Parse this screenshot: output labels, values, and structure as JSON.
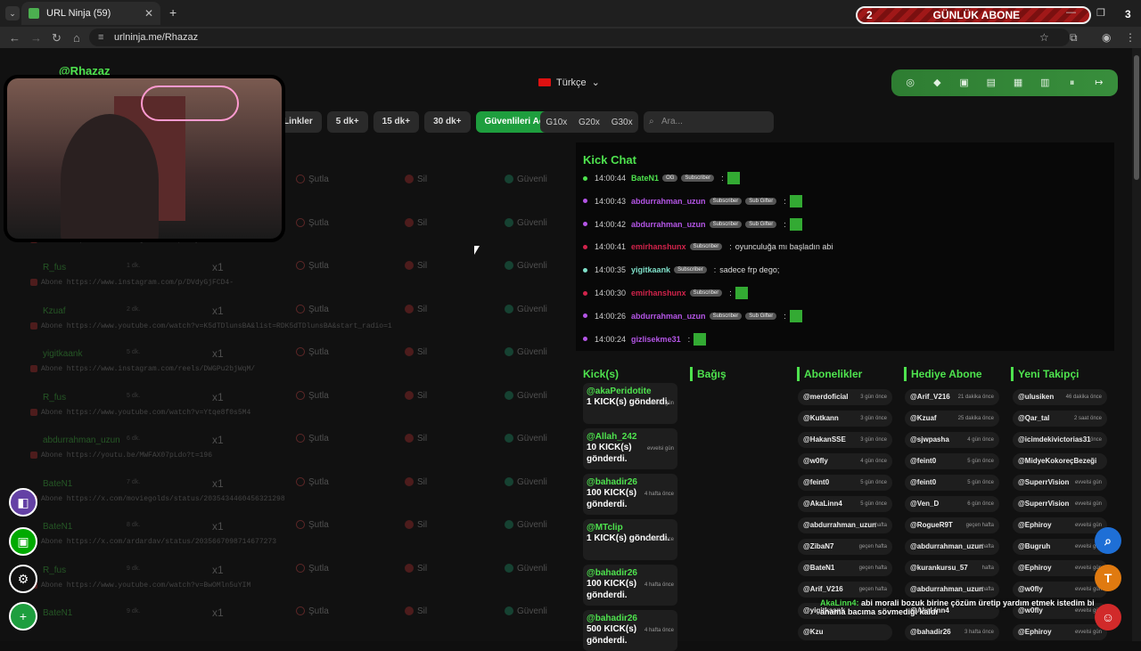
{
  "browser": {
    "tab_title": "URL Ninja (59)",
    "tab_close": "✕",
    "new_tab": "+",
    "url": "urlninja.me/Rhazaz",
    "sub_left": "2",
    "sub_label": "GÜNLÜK ABONE",
    "sub_right": "3"
  },
  "header": {
    "username": "@Rhazaz",
    "language": "Türkçe"
  },
  "filters": {
    "links": "Linkler",
    "b5": "5 dk+",
    "b15": "15 dk+",
    "b30": "30 dk+",
    "safe": "Güvenlileri Aç",
    "g10": "G10x",
    "g20": "G20x",
    "g30": "G30x",
    "search_placeholder": "Ara..."
  },
  "link_actions": {
    "kick": "Şutla",
    "delete": "Sil",
    "safe": "Güvenli"
  },
  "links": [
    {
      "user": "",
      "time": "",
      "count": "",
      "url": ""
    },
    {
      "user": "",
      "time": "",
      "count": "",
      "url": "Abone https://www.instagram.com/p/DVybGmG0lxa"
    },
    {
      "user": "R_fus",
      "time": "1 dk.",
      "count": "x1",
      "url": "Abone https://www.instagram.com/p/DVdyGjFCD4-"
    },
    {
      "user": "Kzuaf",
      "time": "2 dk.",
      "count": "x1",
      "url": "Abone https://www.youtube.com/watch?v=K5dTDlunsBA&list=RDK5dTDlunsBA&start_radio=1"
    },
    {
      "user": "yigitkaank",
      "time": "5 dk.",
      "count": "x1",
      "url": "Abone https://www.instagram.com/reels/DWGPu2bjWqM/"
    },
    {
      "user": "R_fus",
      "time": "5 dk.",
      "count": "x1",
      "url": "Abone https://www.youtube.com/watch?v=Ytqe8f0s5M4"
    },
    {
      "user": "abdurrahman_uzun",
      "time": "6 dk.",
      "count": "x1",
      "url": "Abone https://youtu.be/MWFAX07pLdo?t=196"
    },
    {
      "user": "BateN1",
      "time": "7 dk.",
      "count": "x1",
      "url": "Abone https://x.com/moviegolds/status/2035434460456321298"
    },
    {
      "user": "BateN1",
      "time": "8 dk.",
      "count": "x1",
      "url": "Abone https://x.com/ardardav/status/2035667098714677273"
    },
    {
      "user": "R_fus",
      "time": "9 dk.",
      "count": "x1",
      "url": "Abone https://www.youtube.com/watch?v=BwOMln5uYIM"
    },
    {
      "user": "BateN1",
      "time": "9 dk.",
      "count": "x1",
      "url": ""
    }
  ],
  "chat": {
    "title": "Kick Chat",
    "messages": [
      {
        "time": "14:00:44",
        "name": "BateN1",
        "color": "#4ee34e",
        "dot": "#4ee34e",
        "badges": [
          "OG",
          "Subscriber"
        ],
        "emote": true,
        "text": ""
      },
      {
        "time": "14:00:43",
        "name": "abdurrahman_uzun",
        "color": "#b455e6",
        "dot": "#b455e6",
        "badges": [
          "Subscriber",
          "Sub Gifter"
        ],
        "emote": true,
        "text": ""
      },
      {
        "time": "14:00:42",
        "name": "abdurrahman_uzun",
        "color": "#b455e6",
        "dot": "#b455e6",
        "badges": [
          "Subscriber",
          "Sub Gifter"
        ],
        "emote": true,
        "text": ""
      },
      {
        "time": "14:00:41",
        "name": "emirhanshunx",
        "color": "#d1234b",
        "dot": "#d1234b",
        "badges": [
          "Subscriber"
        ],
        "emote": false,
        "text": "oyunculuğa mı başladın abi"
      },
      {
        "time": "14:00:35",
        "name": "yigitkaank",
        "color": "#7fe0c9",
        "dot": "#7fe0c9",
        "badges": [
          "Subscriber"
        ],
        "emote": false,
        "text": "sadece frp dego;"
      },
      {
        "time": "14:00:30",
        "name": "emirhanshunx",
        "color": "#d1234b",
        "dot": "#d1234b",
        "badges": [
          "Subscriber"
        ],
        "emote": true,
        "text": ""
      },
      {
        "time": "14:00:26",
        "name": "abdurrahman_uzun",
        "color": "#b455e6",
        "dot": "#b455e6",
        "badges": [
          "Subscriber",
          "Sub Gifter"
        ],
        "emote": true,
        "text": ""
      },
      {
        "time": "14:00:24",
        "name": "gizlisekme31",
        "color": "#b455e6",
        "dot": "#b455e6",
        "badges": [],
        "emote": true,
        "text": ""
      }
    ]
  },
  "columns": {
    "kicks": "Kick(s)",
    "donations": "Bağış",
    "subs": "Abonelikler",
    "gift_subs": "Hediye Abone",
    "followers": "Yeni Takipçi"
  },
  "kicks": [
    {
      "name": "@akaPeridotite",
      "text": "1 KICK(s) gönderdi.",
      "time": "evvelsi gün"
    },
    {
      "name": "@Allah_242",
      "text": "10 KICK(s) gönderdi.",
      "time": "evvelsi gün"
    },
    {
      "name": "@bahadir26",
      "text": "100 KICK(s) gönderdi.",
      "time": "4 hafta önce"
    },
    {
      "name": "@MTclip",
      "text": "1 KICK(s) gönderdi.",
      "time": "4 hafta önce"
    },
    {
      "name": "@bahadir26",
      "text": "100 KICK(s) gönderdi.",
      "time": "4 hafta önce"
    },
    {
      "name": "@bahadir26",
      "text": "500 KICK(s) gönderdi.",
      "time": "4 hafta önce"
    }
  ],
  "subs": [
    {
      "n": "@merdoficial",
      "t": "3 gün önce"
    },
    {
      "n": "@Kutkann",
      "t": "3 gün önce"
    },
    {
      "n": "@HakanSSE",
      "t": "3 gün önce"
    },
    {
      "n": "@w0fly",
      "t": "4 gün önce"
    },
    {
      "n": "@feint0",
      "t": "5 gün önce"
    },
    {
      "n": "@AkaLinn4",
      "t": "5 gün önce"
    },
    {
      "n": "@abdurrahman_uzun",
      "t": "hafta"
    },
    {
      "n": "@ZibaN7",
      "t": "geçen hafta"
    },
    {
      "n": "@BateN1",
      "t": "geçen hafta"
    },
    {
      "n": "@Arif_V216",
      "t": "geçen hafta"
    },
    {
      "n": "@yigitkaank",
      "t": ""
    },
    {
      "n": "@Kzu",
      "t": ""
    }
  ],
  "gift_subs": [
    {
      "n": "@Arif_V216",
      "t": "21 dakika önce"
    },
    {
      "n": "@Kzuaf",
      "t": "25 dakika önce"
    },
    {
      "n": "@sjwpasha",
      "t": "4 gün önce"
    },
    {
      "n": "@feint0",
      "t": "5 gün önce"
    },
    {
      "n": "@feint0",
      "t": "5 gün önce"
    },
    {
      "n": "@Ven_D",
      "t": "6 gün önce"
    },
    {
      "n": "@RogueR9T",
      "t": "geçen hafta"
    },
    {
      "n": "@abdurrahman_uzun",
      "t": "hafta"
    },
    {
      "n": "@kurankursu_57",
      "t": "hafta"
    },
    {
      "n": "@abdurrahman_uzun",
      "t": "hafta"
    },
    {
      "n": "@AkaLinn4",
      "t": ""
    },
    {
      "n": "@bahadir26",
      "t": "3 hafta önce"
    }
  ],
  "followers": [
    {
      "n": "@ulusiken",
      "t": "46 dakika önce"
    },
    {
      "n": "@Qar_tal",
      "t": "2 saat önce"
    },
    {
      "n": "@icimdekivictorias31",
      "t": "önce"
    },
    {
      "n": "@MidyeKokoreçBezeği",
      "t": ""
    },
    {
      "n": "@SuperrVision",
      "t": "evvelsi gün"
    },
    {
      "n": "@SuperrVision",
      "t": "evvelsi gün"
    },
    {
      "n": "@Ephiroy",
      "t": "evvelsi gün"
    },
    {
      "n": "@Bugruh",
      "t": "evvelsi gün"
    },
    {
      "n": "@Ephiroy",
      "t": "evvelsi gün"
    },
    {
      "n": "@w0fly",
      "t": "evvelsi gün"
    },
    {
      "n": "@w0fly",
      "t": "evvelsi gün"
    },
    {
      "n": "@Ephiroy",
      "t": "evvelsi gün"
    }
  ],
  "overlay": {
    "name": "AkaLinn4:",
    "line1": "abi morali bozuk birine çözüm üretip yardım etmek istedim bi",
    "line2": "anama bacıma sövmediği kaldı"
  },
  "fab": {
    "search": "⌕",
    "t": "T"
  }
}
